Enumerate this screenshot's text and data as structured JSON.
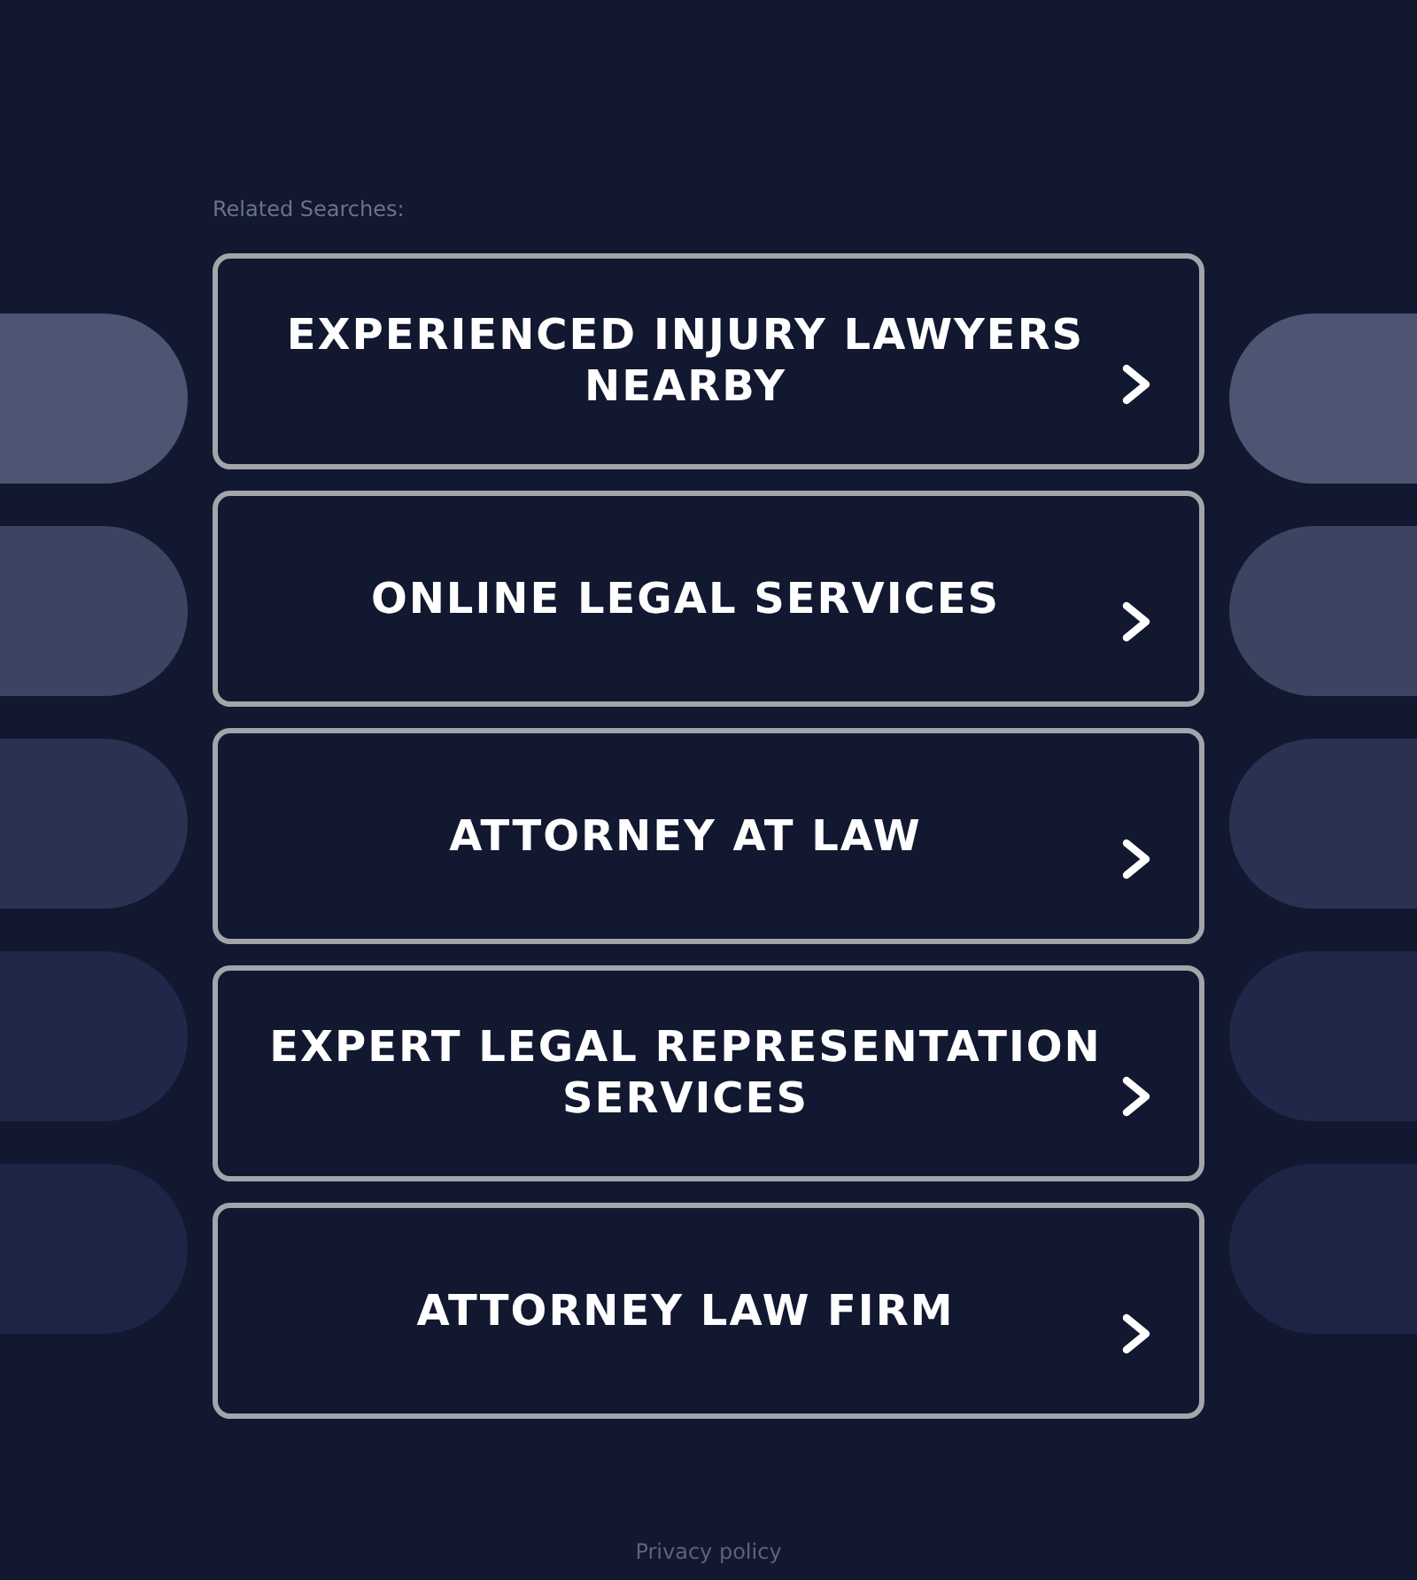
{
  "related_searches": {
    "label": "Related Searches:",
    "links": [
      {
        "text": "EXPERIENCED INJURY LAWYERS NEARBY"
      },
      {
        "text": "ONLINE LEGAL SERVICES"
      },
      {
        "text": "ATTORNEY AT LAW"
      },
      {
        "text": "EXPERT LEGAL REPRESENTATION SERVICES"
      },
      {
        "text": "ATTORNEY LAW FIRM"
      }
    ]
  },
  "footer": {
    "privacy_link": "Privacy policy"
  }
}
